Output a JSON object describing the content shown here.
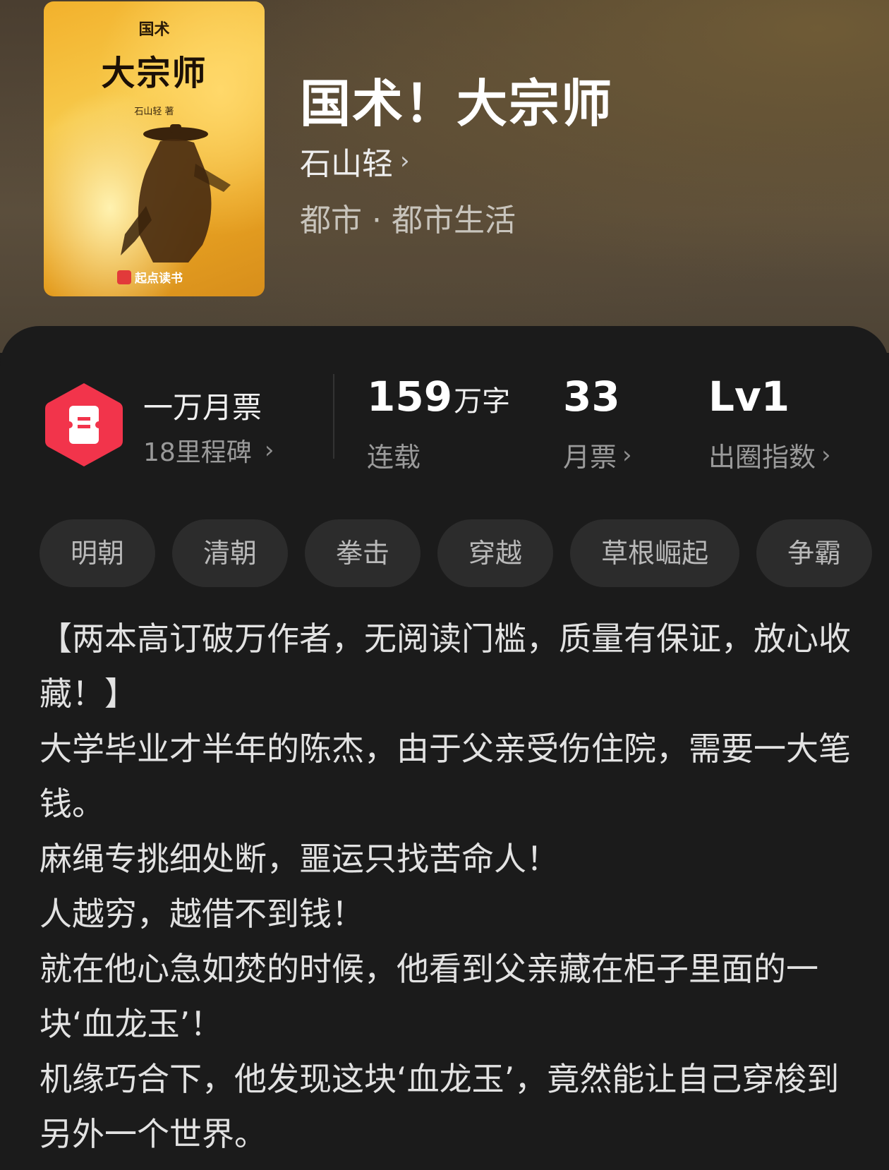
{
  "book": {
    "cover": {
      "top_text": "国术",
      "title_text": "大宗师",
      "author_text": "石山轻 著",
      "brand": "起点读书"
    },
    "title": "国术！大宗师",
    "author": "石山轻",
    "category": "都市 · 都市生活"
  },
  "milestone": {
    "title": "一万月票",
    "subtitle": "18里程碑",
    "icon": "ticket-hexagon-icon",
    "badge_color": "#f2344b"
  },
  "stats": {
    "words_value": "159",
    "words_unit": "万字",
    "words_label": "连载",
    "tickets_value": "33",
    "tickets_label": "月票",
    "influence_value": "Lv1",
    "influence_label": "出圈指数"
  },
  "tags": [
    "明朝",
    "清朝",
    "拳击",
    "穿越",
    "草根崛起",
    "争霸"
  ],
  "description": [
    "【两本高订破万作者，无阅读门槛，质量有保证，放心收藏！】",
    "大学毕业才半年的陈杰，由于父亲受伤住院，需要一大笔钱。",
    "麻绳专挑细处断，噩运只找苦命人！",
    "人越穷，越借不到钱！",
    "就在他心急如焚的时候，他看到父亲藏在柜子里面的一块‘血龙玉’！",
    "机缘巧合下，他发现这块‘血龙玉’，竟然能让自己穿梭到另外一个世界。"
  ]
}
